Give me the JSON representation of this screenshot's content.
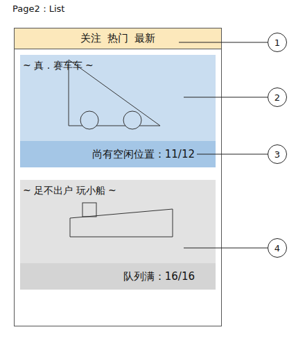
{
  "page_label": "Page2：List",
  "tabs": [
    {
      "label": "关注"
    },
    {
      "label": "热门"
    },
    {
      "label": "最新"
    }
  ],
  "cards": [
    {
      "title": "~ 真 . 赛车车 ~",
      "status": "尚有空闲位置：11/12",
      "full": false,
      "kind": "car"
    },
    {
      "title": "~ 足不出户 玩小船 ~",
      "status": "队列满：16/16",
      "full": true,
      "kind": "boat"
    }
  ],
  "callouts": [
    "1",
    "2",
    "3",
    "4"
  ]
}
